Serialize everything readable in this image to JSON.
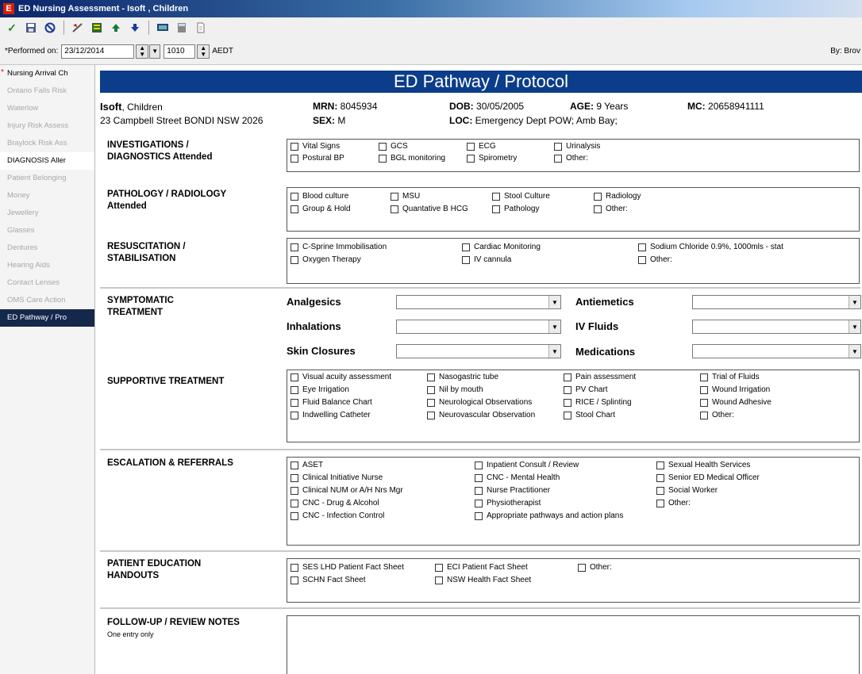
{
  "window": {
    "title": "ED Nursing Assessment - Isoft , Children",
    "app_icon": "E"
  },
  "toolbar": {
    "icons": [
      "check-icon",
      "save-icon",
      "cancel-icon",
      "edit-icon",
      "form-icon",
      "up-arrow-icon",
      "down-arrow-icon",
      "monitor-icon",
      "calculator-icon",
      "document-icon"
    ]
  },
  "performed": {
    "label": "*Performed on:",
    "date": "23/12/2014",
    "time": "1010",
    "timezone": "AEDT",
    "by_label": "By: Brov"
  },
  "nav": {
    "items": [
      {
        "label": "Nursing Arrival Ch",
        "state": "required",
        "star": "*"
      },
      {
        "label": "Ontario Falls Risk",
        "state": "disabled"
      },
      {
        "label": "Waterlow",
        "state": "disabled"
      },
      {
        "label": "Injury Risk Assess",
        "state": "disabled"
      },
      {
        "label": "Braylock Risk Ass",
        "state": "disabled"
      },
      {
        "label": "DIAGNOSIS Aller",
        "state": "done"
      },
      {
        "label": "Patient Belonging",
        "state": "disabled"
      },
      {
        "label": "Money",
        "state": "disabled"
      },
      {
        "label": "Jewellery",
        "state": "disabled"
      },
      {
        "label": "Glasses",
        "state": "disabled"
      },
      {
        "label": "Dentures",
        "state": "disabled"
      },
      {
        "label": "Hearing Aids",
        "state": "disabled"
      },
      {
        "label": "Contact Lenses",
        "state": "disabled"
      },
      {
        "label": "OMS Care Action",
        "state": "disabled"
      },
      {
        "label": "ED Pathway / Pro",
        "state": "active"
      }
    ]
  },
  "form": {
    "title": "ED Pathway / Protocol",
    "patient": {
      "surname": "Isoft",
      "given": ", Children",
      "address": "23 Campbell Street BONDI NSW 2026",
      "mrn_label": "MRN:",
      "mrn": "8045934",
      "sex_label": "SEX:",
      "sex": "M",
      "dob_label": "DOB:",
      "dob": "30/05/2005",
      "age_label": "AGE:",
      "age": "9 Years",
      "loc_label": "LOC:",
      "loc": "Emergency Dept POW; Amb Bay;",
      "mc_label": "MC:",
      "mc": "20658941111"
    },
    "investigations": {
      "label_line1": "INVESTIGATIONS /",
      "label_line2": "DIAGNOSTICS Attended",
      "items": [
        "Vital Signs",
        "GCS",
        "ECG",
        "Urinalysis",
        "Postural BP",
        "BGL monitoring",
        "Spirometry",
        "Other:"
      ]
    },
    "pathology": {
      "label_line1": "PATHOLOGY / RADIOLOGY",
      "label_line2": "Attended",
      "items": [
        "Blood culture",
        "MSU",
        "Stool Culture",
        "Radiology",
        "Group & Hold",
        "Quantative B HCG",
        "Pathology",
        "Other:"
      ]
    },
    "resuscitation": {
      "label_line1": "RESUSCITATION /",
      "label_line2": "STABILISATION",
      "items": [
        "C-Sprine Immobilisation",
        "Cardiac Monitoring",
        "Sodium Chloride 0.9%, 1000mls - stat",
        "Oxygen Therapy",
        "IV cannula",
        "Other:"
      ]
    },
    "symptomatic": {
      "label_line1": "SYMPTOMATIC",
      "label_line2": "TREATMENT",
      "analgesics": "Analgesics",
      "antiemetics": "Antiemetics",
      "inhalations": "Inhalations",
      "iv_fluids": "IV Fluids",
      "skin_closures": "Skin Closures",
      "medications": "Medications"
    },
    "supportive": {
      "label": "SUPPORTIVE TREATMENT",
      "items": [
        "Visual acuity assessment",
        "Nasogastric tube",
        "Pain assessment",
        "Trial of Fluids",
        "Eye Irrigation",
        "Nil by mouth",
        "PV Chart",
        "Wound Irrigation",
        "Fluid Balance Chart",
        "Neurological Observations",
        "RICE / Splinting",
        "Wound Adhesive",
        "Indwelling Catheter",
        "Neurovascular Observation",
        "Stool Chart",
        "Other:"
      ]
    },
    "escalation": {
      "label": "ESCALATION & REFERRALS",
      "items": [
        "ASET",
        "Inpatient Consult / Review",
        "Sexual Health Services",
        "Clinical Initiative Nurse",
        "CNC - Mental Health",
        "Senior ED Medical Officer",
        "Clinical NUM or A/H Nrs Mgr",
        "Nurse Practitioner",
        "Social Worker",
        "CNC - Drug & Alcohol",
        "Physiotherapist",
        "Other:",
        "CNC - Infection Control",
        "Appropriate pathways and action plans"
      ]
    },
    "education": {
      "label_line1": "PATIENT EDUCATION",
      "label_line2": "HANDOUTS",
      "items": [
        "SES LHD Patient Fact Sheet",
        "ECI Patient Fact Sheet",
        "Other:",
        "SCHN Fact Sheet",
        "NSW Health Fact Sheet"
      ]
    },
    "followup": {
      "label": "FOLLOW-UP / REVIEW NOTES",
      "sublabel": "One entry only"
    }
  }
}
